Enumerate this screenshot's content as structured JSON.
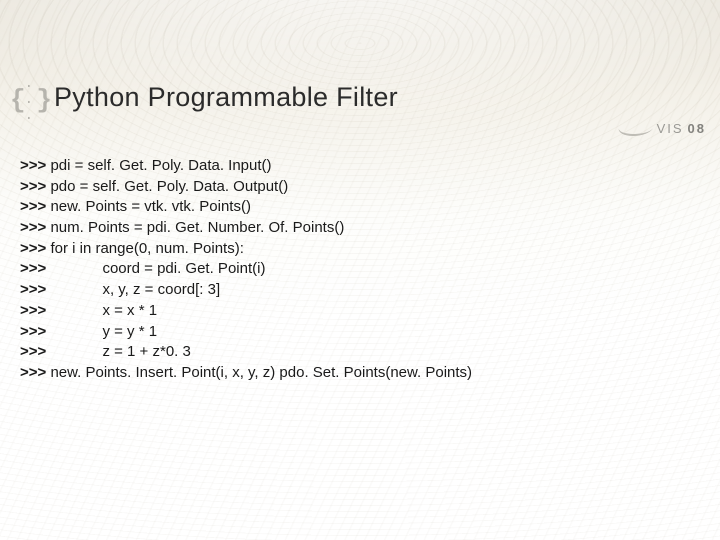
{
  "title": "Python Programmable Filter",
  "bullet_glyph": {
    "left": "{",
    "dots": ". . .",
    "right": "}"
  },
  "logo": {
    "text_light": "VIS",
    "text_bold": "08"
  },
  "prompt": ">>>",
  "code_lines": [
    {
      "indent": 0,
      "text": "pdi = self. Get. Poly. Data. Input()"
    },
    {
      "indent": 0,
      "text": "pdo = self. Get. Poly. Data. Output()"
    },
    {
      "indent": 0,
      "text": "new. Points = vtk. vtk. Points()"
    },
    {
      "indent": 0,
      "text": "num. Points = pdi. Get. Number. Of. Points()"
    },
    {
      "indent": 0,
      "text": "for i in range(0, num. Points):"
    },
    {
      "indent": 1,
      "text": "coord = pdi. Get. Point(i)"
    },
    {
      "indent": 1,
      "text": "x, y, z = coord[: 3]"
    },
    {
      "indent": 1,
      "text": "x = x * 1"
    },
    {
      "indent": 1,
      "text": "y = y * 1"
    },
    {
      "indent": 1,
      "text": "z = 1 + z*0. 3"
    },
    {
      "indent": 0,
      "text": "new. Points. Insert. Point(i, x, y, z) pdo. Set. Points(new. Points)"
    }
  ]
}
